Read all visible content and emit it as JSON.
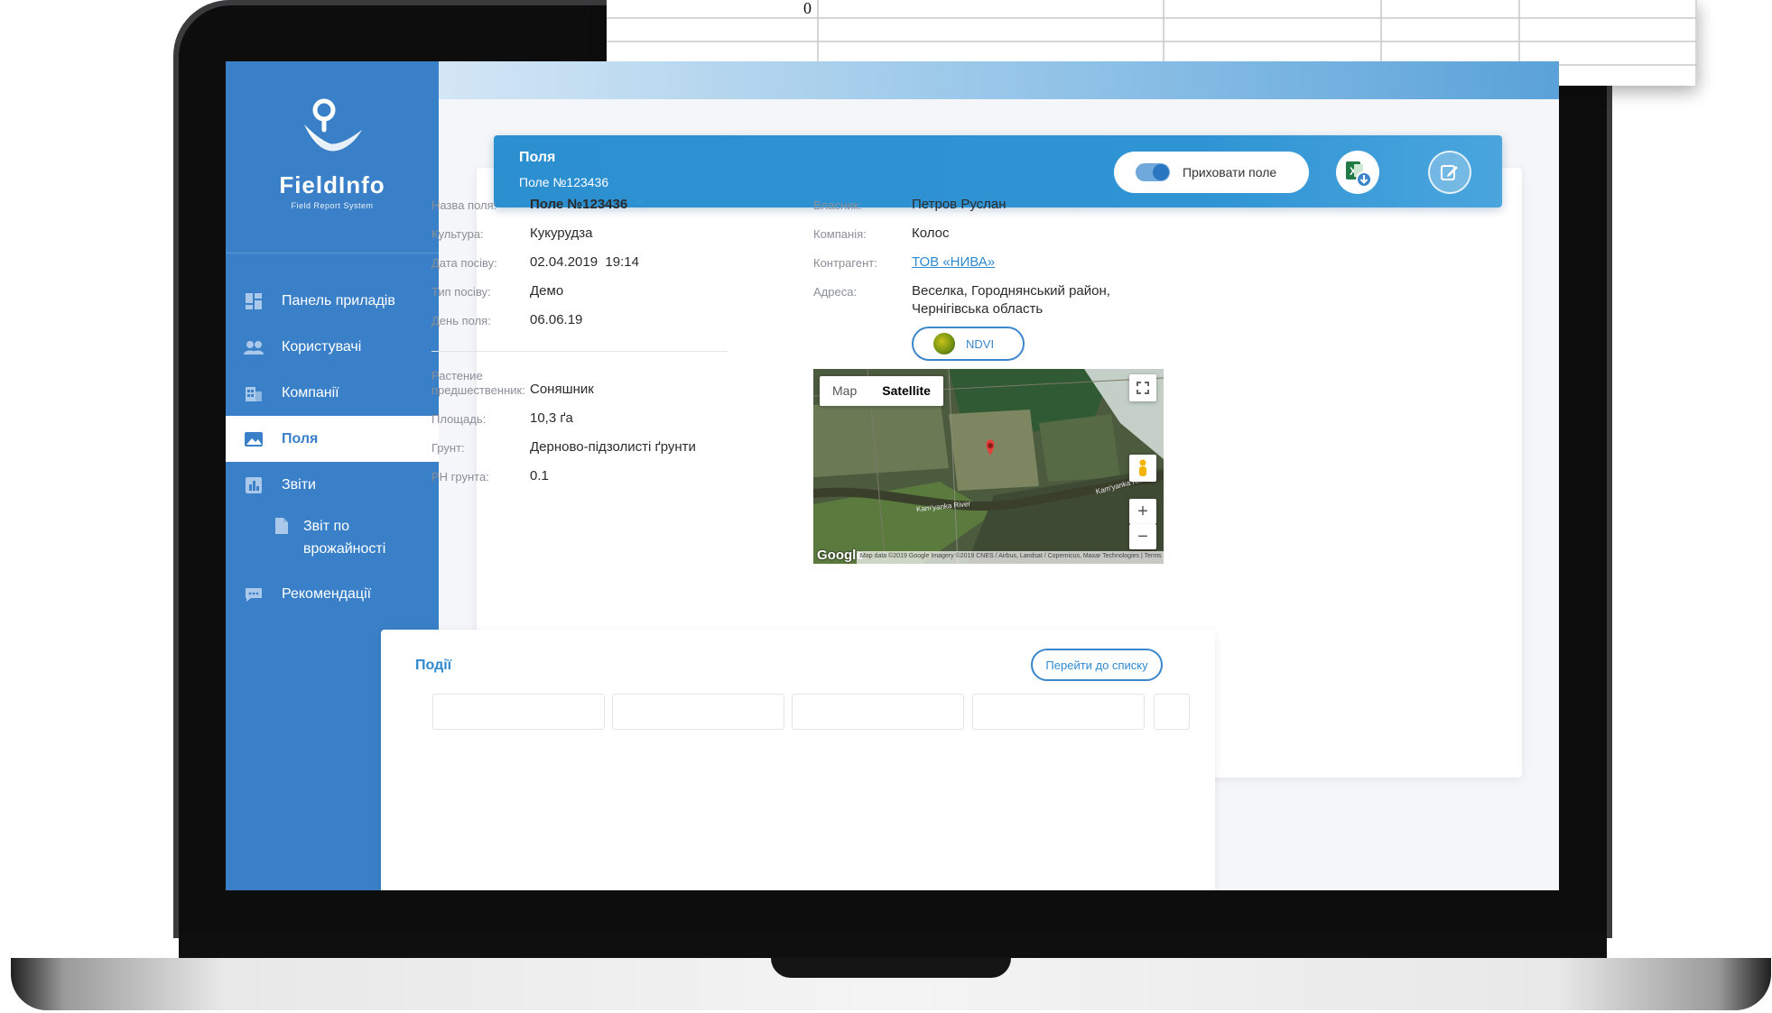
{
  "spreadsheet": {
    "cell_value": "0"
  },
  "app": {
    "logo_name": "FieldInfo",
    "logo_tagline": "Field Report System"
  },
  "sidebar": {
    "items": [
      {
        "label": "Панель приладів",
        "icon": "dashboard-icon"
      },
      {
        "label": "Користувачі",
        "icon": "users-icon"
      },
      {
        "label": "Компанії",
        "icon": "building-icon"
      },
      {
        "label": "Поля",
        "icon": "image-icon",
        "active": true
      },
      {
        "label": "Звіти",
        "icon": "chart-icon"
      },
      {
        "label": "Звіт по врожайності",
        "icon": "document-icon",
        "sub": true
      },
      {
        "label": "Рекомендації",
        "icon": "chat-icon"
      }
    ]
  },
  "header": {
    "title": "Поля",
    "subtitle": "Поле №123436",
    "toggle_label": "Приховати поле"
  },
  "details_left": [
    {
      "label": "Назва поля:",
      "value": "Поле №123436"
    },
    {
      "label": "Культура:",
      "value": "Кукурудза"
    },
    {
      "label": "Дата посіву:",
      "value": "02.04.2019  19:14"
    },
    {
      "label": "Тип посіву:",
      "value": "Демо"
    },
    {
      "label": "День поля:",
      "value": "06.06.19"
    }
  ],
  "details_left2": [
    {
      "label_line1": "Растение",
      "label_line2": "предшественник:",
      "value": "Соняшник"
    },
    {
      "label": "Площадь:",
      "value": "10,3 ґа"
    },
    {
      "label": "Грунт:",
      "value": "Дерново-підзолисті ґрунти"
    },
    {
      "label": "PH грунта:",
      "value": "0.1"
    }
  ],
  "details_right": [
    {
      "label": "Власник:",
      "value": "Петров Руслан"
    },
    {
      "label": "Компанія:",
      "value": "Колос"
    },
    {
      "label": "Контрагент:",
      "value": "ТОВ «НИВА»"
    },
    {
      "label": "Адреса:",
      "value_line1": "Веселка, Городнянський район,",
      "value_line2": "Чернігівська область"
    }
  ],
  "ndvi_label": "NDVI",
  "map": {
    "tab_map": "Map",
    "tab_satellite": "Satellite",
    "river_label_1": "Kam'yanka River",
    "river_label_2": "Kam'yanka River",
    "google": "Google",
    "attribution": "Map data ©2019 Google Imagery ©2019 CNES / Airbus, Landsat / Copernicus, Maxar Technologies  |  Terms of Use",
    "zoom_in": "+",
    "zoom_out": "−"
  },
  "events": {
    "title": "Події",
    "list_button": "Перейти до списку"
  },
  "colors": {
    "sidebar": "#3a80c8",
    "header": "#2f94d4",
    "accent": "#2f89cf"
  }
}
